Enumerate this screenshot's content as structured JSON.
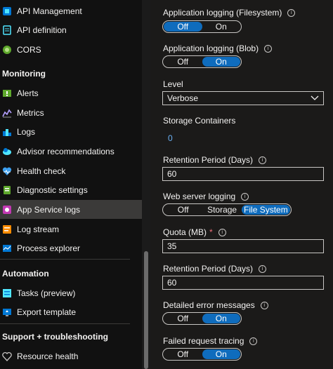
{
  "sidebar": {
    "items": [
      {
        "label": "API Management",
        "icon": "api-management-icon"
      },
      {
        "label": "API definition",
        "icon": "api-definition-icon"
      },
      {
        "label": "CORS",
        "icon": "cors-icon"
      },
      {
        "section": "Monitoring"
      },
      {
        "label": "Alerts",
        "icon": "alerts-icon"
      },
      {
        "label": "Metrics",
        "icon": "metrics-icon"
      },
      {
        "label": "Logs",
        "icon": "logs-icon"
      },
      {
        "label": "Advisor recommendations",
        "icon": "advisor-icon"
      },
      {
        "label": "Health check",
        "icon": "health-check-icon"
      },
      {
        "label": "Diagnostic settings",
        "icon": "diagnostic-settings-icon"
      },
      {
        "label": "App Service logs",
        "icon": "app-service-logs-icon",
        "active": true
      },
      {
        "label": "Log stream",
        "icon": "log-stream-icon"
      },
      {
        "label": "Process explorer",
        "icon": "process-explorer-icon"
      },
      {
        "section": "Automation"
      },
      {
        "label": "Tasks (preview)",
        "icon": "tasks-icon"
      },
      {
        "label": "Export template",
        "icon": "export-template-icon"
      },
      {
        "section": "Support + troubleshooting"
      },
      {
        "label": "Resource health",
        "icon": "resource-health-icon"
      }
    ]
  },
  "form": {
    "app_logging_fs": {
      "label": "Application logging (Filesystem)",
      "off": "Off",
      "on": "On",
      "selected": "Off"
    },
    "app_logging_blob": {
      "label": "Application logging (Blob)",
      "off": "Off",
      "on": "On",
      "selected": "On"
    },
    "level": {
      "label": "Level",
      "value": "Verbose"
    },
    "storage_containers": {
      "label": "Storage Containers",
      "count": "0"
    },
    "retention_blob": {
      "label": "Retention Period (Days)",
      "value": "60"
    },
    "web_server_logging": {
      "label": "Web server logging",
      "off": "Off",
      "storage": "Storage",
      "file_system": "File System",
      "selected": "File System"
    },
    "quota": {
      "label": "Quota (MB)",
      "required": "*",
      "value": "35"
    },
    "retention_fs": {
      "label": "Retention Period (Days)",
      "value": "60"
    },
    "detailed_errors": {
      "label": "Detailed error messages",
      "off": "Off",
      "on": "On",
      "selected": "On"
    },
    "failed_request": {
      "label": "Failed request tracing",
      "off": "Off",
      "on": "On",
      "selected": "On"
    }
  },
  "info_glyph": "i",
  "colors": {
    "accent": "#0f6cbd",
    "background": "#1b1a19",
    "sidebar": "#111111",
    "active_item": "#3b3a39"
  }
}
